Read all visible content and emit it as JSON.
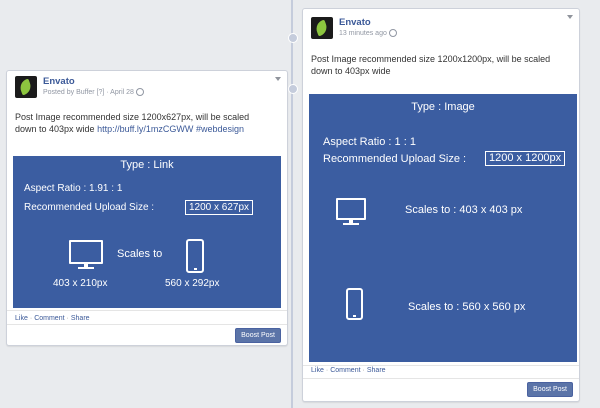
{
  "left_post": {
    "page_name": "Envato",
    "byline": "Posted by Buffer [?] · April 28",
    "message_line1": "Post Image recommended size 1200x627px, will be scaled",
    "message_line2_text": "down to 403px wide ",
    "link": "http://buff.ly/1mzCGWW",
    "hashtag": "#webdesign",
    "media": {
      "type_label": "Type : Link",
      "aspect_ratio": "Aspect Ratio : 1.91 : 1",
      "upload_label": "Recommended Upload Size :",
      "upload_size": "1200 x 627px",
      "scales_to": "Scales to",
      "desktop_size": "403 x 210px",
      "mobile_size": "560 x 292px"
    },
    "actions": {
      "like": "Like",
      "comment": "Comment",
      "share": "Share"
    },
    "boost": "Boost Post"
  },
  "right_post": {
    "page_name": "Envato",
    "timestamp": "13 minutes ago",
    "message_line1": "Post Image recommended size 1200x1200px, will be scaled",
    "message_line2": "down to 403px wide",
    "media": {
      "type_label": "Type : Image",
      "aspect_ratio": "Aspect Ratio : 1 : 1",
      "upload_label": "Recommended Upload Size :",
      "upload_size": "1200 x 1200px",
      "desktop_scales": "Scales to :  403 x 403 px",
      "mobile_scales": "Scales to :  560 x 560 px"
    },
    "actions": {
      "like": "Like",
      "comment": "Comment",
      "share": "Share"
    },
    "boost": "Boost Post"
  },
  "colors": {
    "background": "#e9ebee",
    "media_blue": "#3b5da1",
    "link_blue": "#3b5998",
    "boost_button": "#5b74a8",
    "logo_leaf": "#8dc63f"
  },
  "icons": [
    "envato-logo",
    "globe-icon",
    "chevron-down-icon",
    "monitor-icon",
    "phone-icon"
  ]
}
